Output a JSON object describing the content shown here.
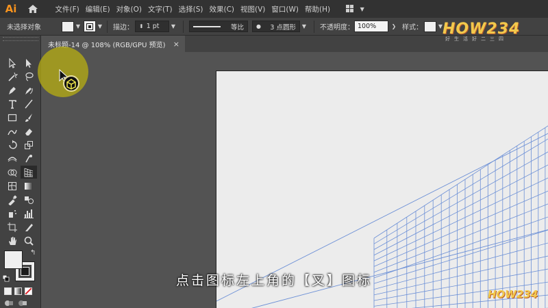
{
  "app": {
    "logo": "Ai",
    "menus": [
      "文件(F)",
      "编辑(E)",
      "对象(O)",
      "文字(T)",
      "选择(S)",
      "效果(C)",
      "视图(V)",
      "窗口(W)",
      "帮助(H)"
    ]
  },
  "control_bar": {
    "selection_status": "未选择对象",
    "stroke_label": "描边：",
    "stroke_weight": "1 pt",
    "stroke_profile": "等比",
    "brush": "3 点圆形",
    "opacity_label": "不透明度：",
    "opacity_value": "100%",
    "style_label": "样式："
  },
  "document_tab": {
    "title": "未标题-14 @ 108% (RGB/GPU 预览)",
    "close_glyph": "×"
  },
  "toolbar": {
    "tools": [
      {
        "name": "selection-tool-icon"
      },
      {
        "name": "direct-selection-tool-icon"
      },
      {
        "name": "magic-wand-tool-icon"
      },
      {
        "name": "lasso-tool-icon"
      },
      {
        "name": "pen-tool-icon"
      },
      {
        "name": "curvature-tool-icon"
      },
      {
        "name": "type-tool-icon"
      },
      {
        "name": "line-segment-tool-icon"
      },
      {
        "name": "rectangle-tool-icon"
      },
      {
        "name": "paintbrush-tool-icon"
      },
      {
        "name": "shaper-tool-icon"
      },
      {
        "name": "eraser-tool-icon"
      },
      {
        "name": "rotate-tool-icon"
      },
      {
        "name": "scale-tool-icon"
      },
      {
        "name": "width-tool-icon"
      },
      {
        "name": "puppet-warp-tool-icon"
      },
      {
        "name": "shape-builder-tool-icon"
      },
      {
        "name": "perspective-grid-tool-icon"
      },
      {
        "name": "mesh-tool-icon"
      },
      {
        "name": "gradient-tool-icon"
      },
      {
        "name": "eyedropper-tool-icon"
      },
      {
        "name": "blend-tool-icon"
      },
      {
        "name": "symbol-sprayer-tool-icon"
      },
      {
        "name": "column-graph-tool-icon"
      },
      {
        "name": "artboard-tool-icon"
      },
      {
        "name": "slice-tool-icon"
      },
      {
        "name": "hand-tool-icon"
      },
      {
        "name": "zoom-tool-icon"
      }
    ],
    "active_tool": "perspective-grid-tool-icon",
    "fill_color": "#efefef",
    "stroke_color": "#efefef"
  },
  "canvas": {
    "artboard_color": "#ececec",
    "grid_color": "#6b8fd6",
    "highlight_color": "#b4aa14"
  },
  "subtitle": "点击图标左上角的【叉】图标",
  "brand": {
    "wordmark": "HOW234",
    "tagline": "好生活好二三四",
    "accent": "#f2c94c"
  }
}
